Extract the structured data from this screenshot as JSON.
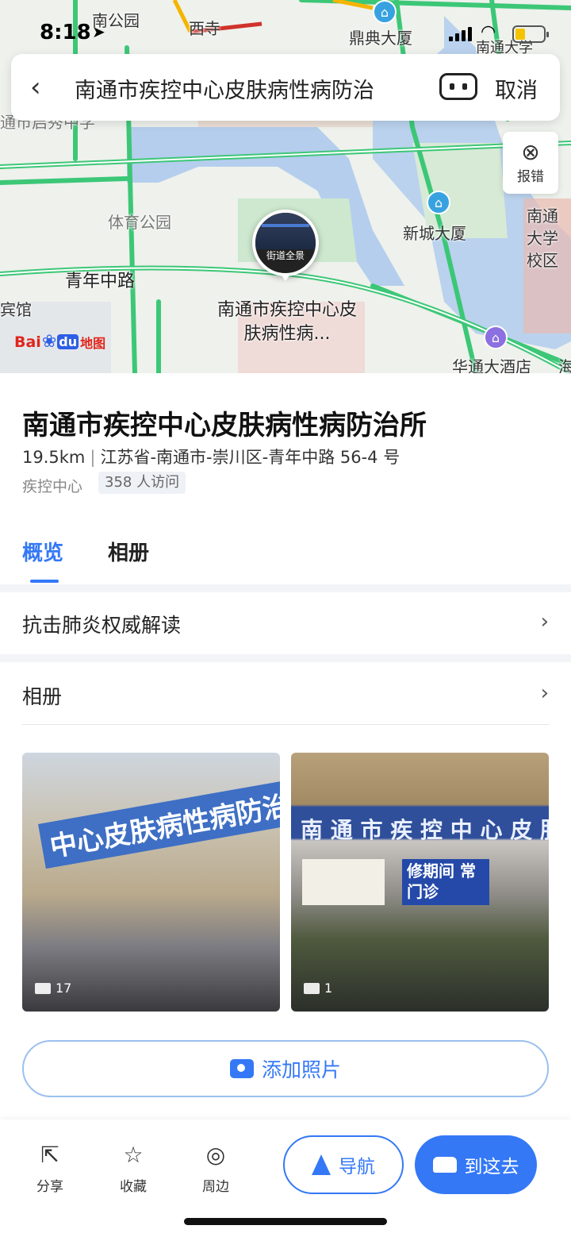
{
  "status_bar": {
    "time": "8:18"
  },
  "search": {
    "query": "南通市疾控中心皮肤病性病防治",
    "cancel_label": "取消"
  },
  "map": {
    "report_label": "报错",
    "panorama_label": "街道全景",
    "place_label": "南通市疾控中心皮肤病性病...",
    "labels": {
      "nan_park": "南公园",
      "xisi": "西寺",
      "dingdian": "鼎典大厦",
      "ntu": "南通大学",
      "school": "通市启秀中学",
      "park": "体育公园",
      "xincheng": "新城大厦",
      "campus": "南通大学校区",
      "road": "青年中路",
      "hotel_left": "宾馆",
      "huatong": "华通大酒店",
      "edge": "海"
    },
    "logo": {
      "bai": "Bai",
      "du": "du",
      "map": "地图"
    }
  },
  "place": {
    "name": "南通市疾控中心皮肤病性病防治所",
    "distance": "19.5km",
    "address": "江苏省-南通市-崇川区-青年中路 56-4 号",
    "category": "疾控中心",
    "visits": "358 人访问"
  },
  "tabs": [
    {
      "label": "概览",
      "active": true
    },
    {
      "label": "相册",
      "active": false
    }
  ],
  "rows": {
    "covid": "抗击肺炎权威解读",
    "album": "相册"
  },
  "photos": [
    {
      "sign": "中心皮肤病性病防治",
      "count": "17"
    },
    {
      "sign": "南 通 市 疾 控 中 心 皮 肤 病",
      "clinic": "修期间 常门诊",
      "count": "1"
    }
  ],
  "add_photo_label": "添加照片",
  "bottom_bar": {
    "share": "分享",
    "favorite": "收藏",
    "nearby": "周边",
    "navigate": "导航",
    "go_here": "到这去"
  },
  "colors": {
    "accent": "#3478f6",
    "road_green": "#3cc777",
    "water": "#8fb8ef"
  },
  "icons": [
    "back-arrow-icon",
    "voice-icon",
    "report-pin-icon",
    "share-icon",
    "star-icon",
    "compass-icon",
    "navigation-arrow-icon",
    "car-icon",
    "camera-icon"
  ]
}
